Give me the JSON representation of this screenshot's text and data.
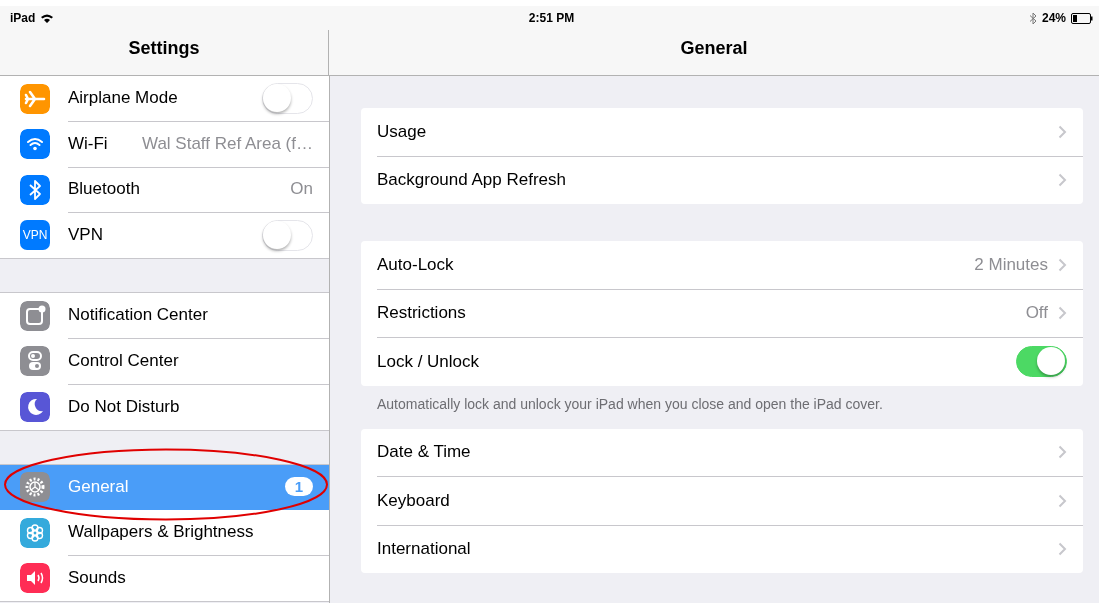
{
  "status_bar": {
    "device": "iPad",
    "time": "2:51 PM",
    "battery": "24%"
  },
  "sidebar": {
    "title": "Settings",
    "groups": [
      {
        "items": [
          {
            "label": "Airplane Mode",
            "kind": "toggle",
            "on": false,
            "selected": false
          },
          {
            "label": "Wi-Fi",
            "kind": "value",
            "value": "Wal Staff Ref Area (f…",
            "selected": false
          },
          {
            "label": "Bluetooth",
            "kind": "value",
            "value": "On",
            "selected": false
          },
          {
            "label": "VPN",
            "kind": "toggle",
            "on": false,
            "icon_text": "VPN",
            "selected": false
          }
        ]
      },
      {
        "items": [
          {
            "label": "Notification Center",
            "kind": "plain",
            "selected": false
          },
          {
            "label": "Control Center",
            "kind": "plain",
            "selected": false
          },
          {
            "label": "Do Not Disturb",
            "kind": "plain",
            "selected": false
          }
        ]
      },
      {
        "items": [
          {
            "label": "General",
            "kind": "badge",
            "badge": "1",
            "selected": true
          },
          {
            "label": "Wallpapers & Brightness",
            "kind": "plain",
            "selected": false
          },
          {
            "label": "Sounds",
            "kind": "plain",
            "selected": false
          }
        ]
      }
    ]
  },
  "detail": {
    "title": "General",
    "groups": [
      {
        "items": [
          {
            "label": "Usage",
            "kind": "chevron"
          },
          {
            "label": "Background App Refresh",
            "kind": "chevron"
          }
        ]
      },
      {
        "items": [
          {
            "label": "Auto-Lock",
            "kind": "chevron",
            "value": "2 Minutes"
          },
          {
            "label": "Restrictions",
            "kind": "chevron",
            "value": "Off"
          },
          {
            "label": "Lock / Unlock",
            "kind": "toggle",
            "on": true
          }
        ],
        "footer": "Automatically lock and unlock your iPad when you close and open the iPad cover."
      },
      {
        "items": [
          {
            "label": "Date & Time",
            "kind": "chevron"
          },
          {
            "label": "Keyboard",
            "kind": "chevron"
          },
          {
            "label": "International",
            "kind": "chevron"
          }
        ]
      }
    ]
  }
}
